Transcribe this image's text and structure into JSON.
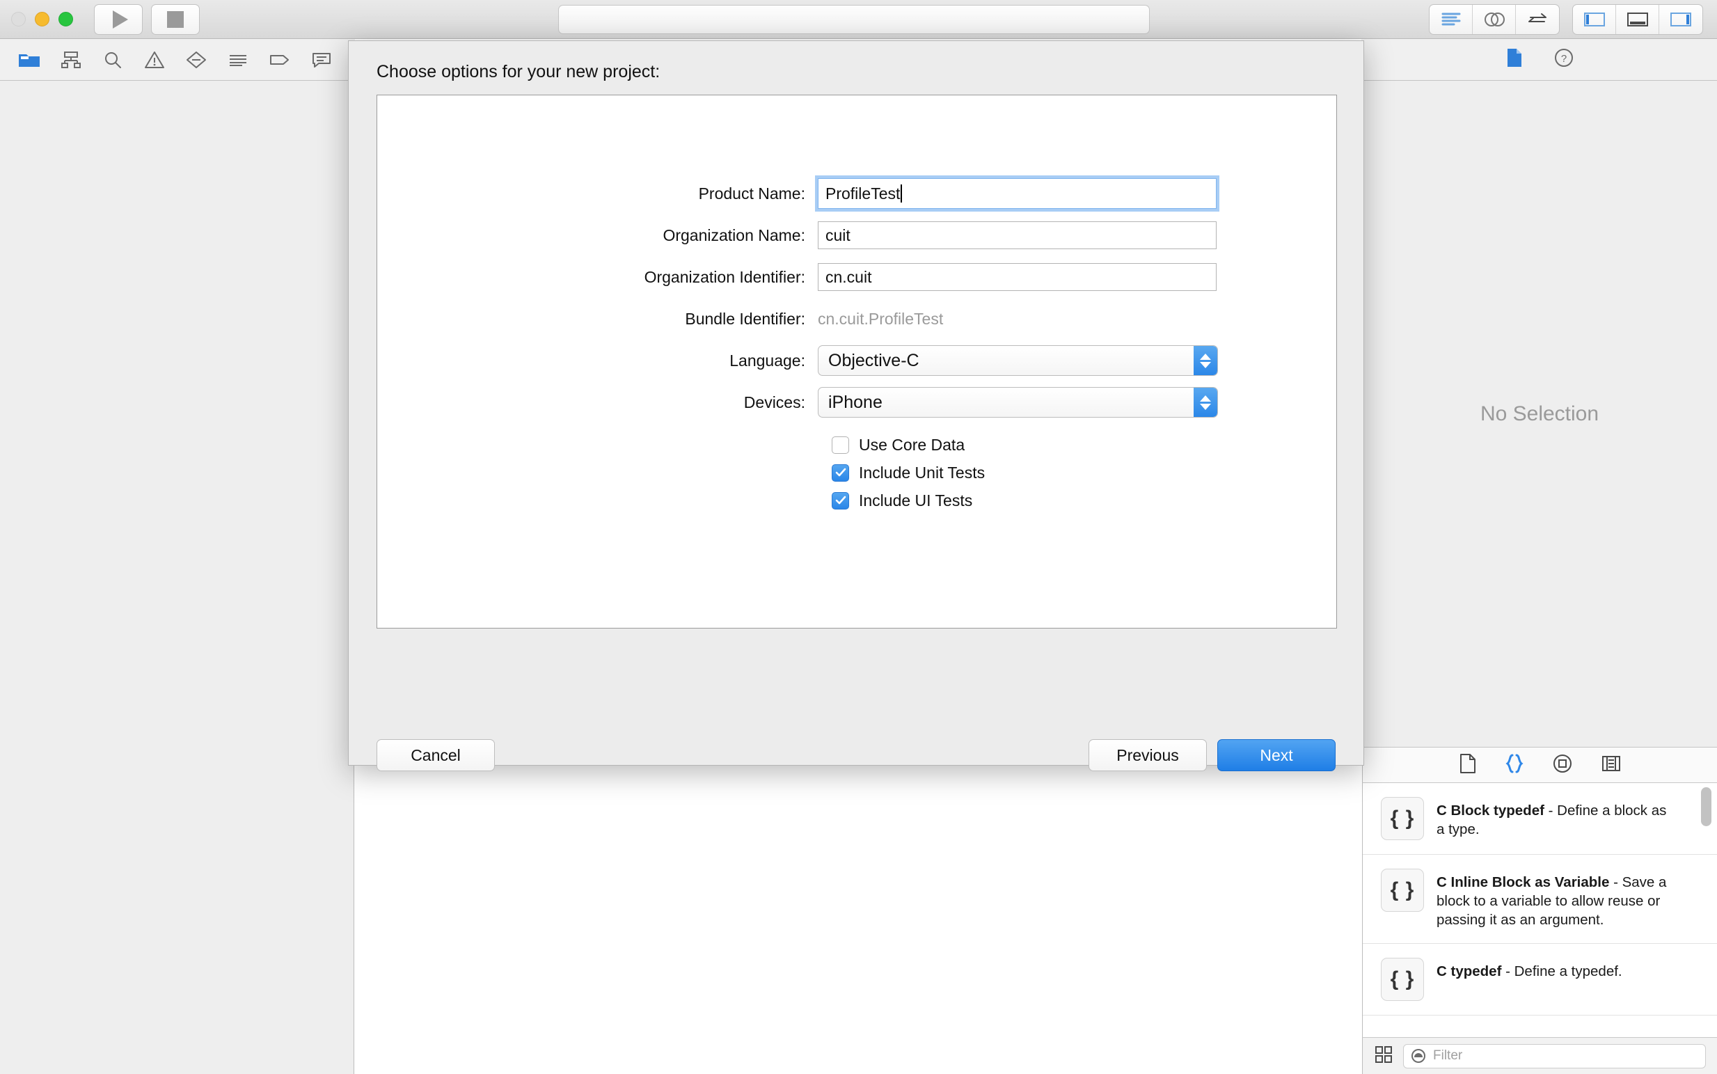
{
  "titlebar": {
    "traffic_lights": [
      "close-disabled",
      "minimize",
      "zoom"
    ],
    "run_button_label": "Run",
    "stop_button_label": "Stop",
    "activity_value": "",
    "editor_modes": [
      "standard-editor",
      "assistant-editor",
      "version-editor"
    ],
    "view_toggles": [
      "navigator-toggle",
      "debug-area-toggle",
      "utilities-toggle"
    ]
  },
  "navigator": {
    "tabs": [
      "project-navigator",
      "symbol-navigator",
      "find-navigator",
      "issue-navigator",
      "test-navigator",
      "debug-navigator",
      "breakpoint-navigator",
      "report-navigator"
    ],
    "selected": "project-navigator"
  },
  "utility": {
    "tabs": [
      "file-inspector",
      "quick-help-inspector"
    ],
    "no_selection_text": "No Selection"
  },
  "library": {
    "tabs": [
      "file-template-library",
      "code-snippet-library",
      "object-library",
      "media-library"
    ],
    "selected": "code-snippet-library",
    "snippets": [
      {
        "title": "C Block typedef",
        "dash": " - ",
        "desc": "Define a block as a type.",
        "icon": "{ }"
      },
      {
        "title": "C Inline Block as Variable",
        "dash": " - ",
        "desc": "Save a block to a variable to allow reuse or passing it as an argument.",
        "icon": "{ }"
      },
      {
        "title": "C typedef",
        "dash": " - ",
        "desc": "Define a typedef.",
        "icon": "{ }"
      }
    ],
    "filter_placeholder": "Filter",
    "filter_value": ""
  },
  "dialog": {
    "title": "Choose options for your new project:",
    "fields": [
      {
        "label": "Product Name:",
        "value": "ProfileTest",
        "type": "text",
        "focused": true
      },
      {
        "label": "Organization Name:",
        "value": "cuit",
        "type": "text",
        "focused": false
      },
      {
        "label": "Organization Identifier:",
        "value": "cn.cuit",
        "type": "text",
        "focused": false
      },
      {
        "label": "Bundle Identifier:",
        "value": "cn.cuit.ProfileTest",
        "type": "static",
        "focused": false
      },
      {
        "label": "Language:",
        "value": "Objective-C",
        "type": "popup",
        "focused": false
      },
      {
        "label": "Devices:",
        "value": "iPhone",
        "type": "popup",
        "focused": false
      }
    ],
    "checkboxes": [
      {
        "label": "Use Core Data",
        "checked": false
      },
      {
        "label": "Include Unit Tests",
        "checked": true
      },
      {
        "label": "Include UI Tests",
        "checked": true
      }
    ],
    "buttons": {
      "cancel": "Cancel",
      "previous": "Previous",
      "next": "Next"
    },
    "accent_color": "#2a86e8"
  }
}
